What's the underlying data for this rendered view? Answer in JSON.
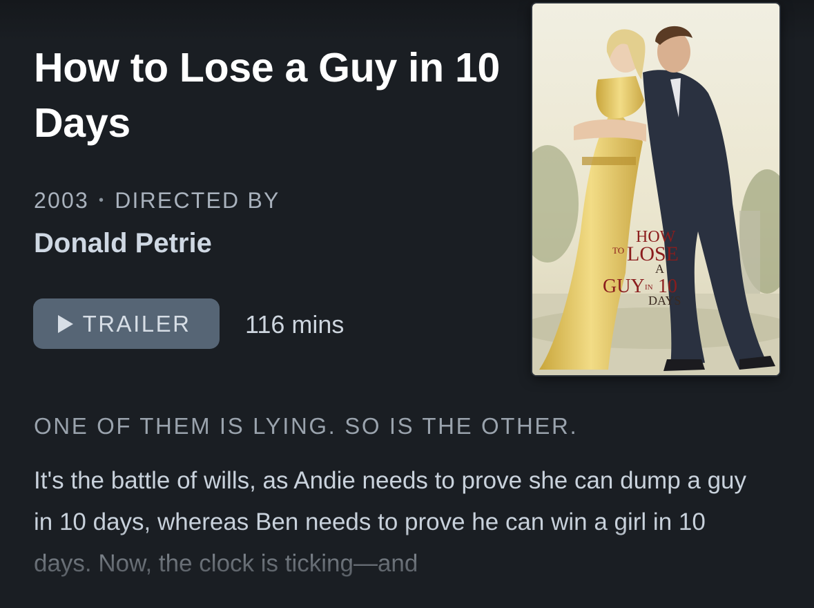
{
  "movie": {
    "title": "How to Lose a Guy in 10 Days",
    "year": "2003",
    "directed_by_label": "DIRECTED BY",
    "director": "Donald Petrie",
    "trailer_label": "TRAILER",
    "runtime": "116 mins",
    "tagline": "ONE OF THEM IS LYING. SO IS THE OTHER.",
    "synopsis": "It's the battle of wills, as Andie needs to prove she can dump a guy in 10 days, whereas Ben needs to prove he can win a girl in 10 days. Now, the clock is ticking—and"
  },
  "poster": {
    "logo": {
      "how": "HOW",
      "to": "TO",
      "lose": "LOSE",
      "a": "A",
      "guy": "GUY",
      "in": "IN",
      "num": "10",
      "days": "DAYS"
    }
  },
  "icons": {
    "trailer_button": "play-icon"
  },
  "colors": {
    "background": "#1a1e23",
    "button": "#566575",
    "title": "#ffffff"
  }
}
